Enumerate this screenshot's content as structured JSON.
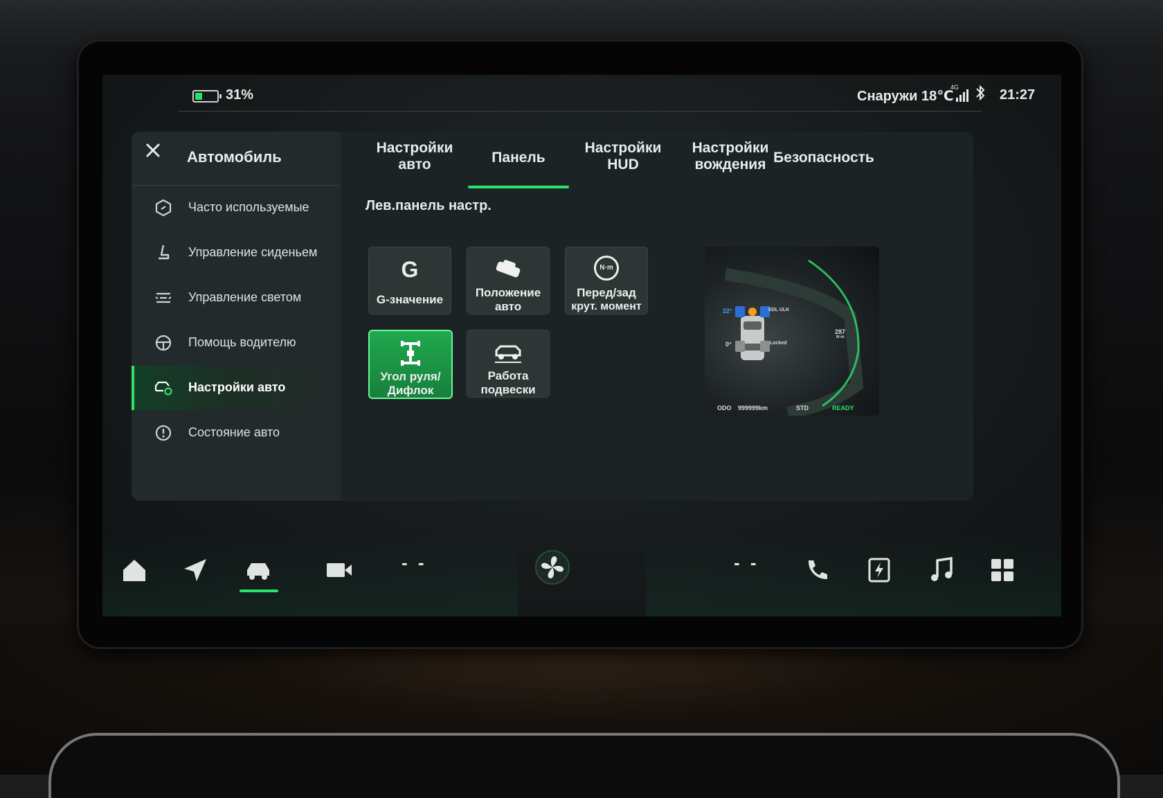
{
  "status": {
    "battery_pct": "31%",
    "outside_temp": "Снаружи 18℃",
    "network": "4G",
    "time": "21:27"
  },
  "sidebar": {
    "title": "Автомобиль",
    "items": [
      {
        "label": "Часто используемые",
        "icon": "hexagon-icon"
      },
      {
        "label": "Управление сиденьем",
        "icon": "seat-icon"
      },
      {
        "label": "Управление светом",
        "icon": "light-icon"
      },
      {
        "label": "Помощь водителю",
        "icon": "steering-wheel-icon"
      },
      {
        "label": "Настройки авто",
        "icon": "car-settings-icon",
        "active": true
      },
      {
        "label": "Состояние авто",
        "icon": "car-status-icon"
      }
    ]
  },
  "tabs": [
    {
      "line1": "Настройки",
      "line2": "авто"
    },
    {
      "line1": "Панель",
      "line2": "",
      "active": true
    },
    {
      "line1": "Настройки",
      "line2": "HUD"
    },
    {
      "line1": "Настройки",
      "line2": "вождения"
    },
    {
      "line1": "Безопасность",
      "line2": ""
    }
  ],
  "section_title": "Лев.панель настр.",
  "tiles": [
    {
      "icon": "g-value-icon",
      "glyph": "G",
      "line1": "G-значение",
      "line2": ""
    },
    {
      "icon": "car-position-icon",
      "line1": "Положение",
      "line2": "авто"
    },
    {
      "icon": "torque-icon",
      "glyph": "N·m",
      "line1": "Перед/зад",
      "line2": "крут. момент"
    },
    {
      "icon": "axle-icon",
      "line1": "Угол руля/",
      "line2": "Дифлок",
      "active": true
    },
    {
      "icon": "suspension-icon",
      "line1": "Работа",
      "line2": "подвески"
    }
  ],
  "preview": {
    "angle_top": "22°",
    "angle_bottom": "0°",
    "edl": "EDL ULK",
    "locked": "Locked",
    "torque": "287",
    "torque_unit": "N·m",
    "odo_label": "ODO",
    "odo_value": "999999km",
    "mode": "STD",
    "ready": "READY"
  },
  "nav": {
    "left_temp": "- -",
    "right_temp": "- -"
  },
  "colors": {
    "accent": "#2fe06b",
    "panel_bg": "#1c2324",
    "sidebar_bg": "#232a2b"
  }
}
